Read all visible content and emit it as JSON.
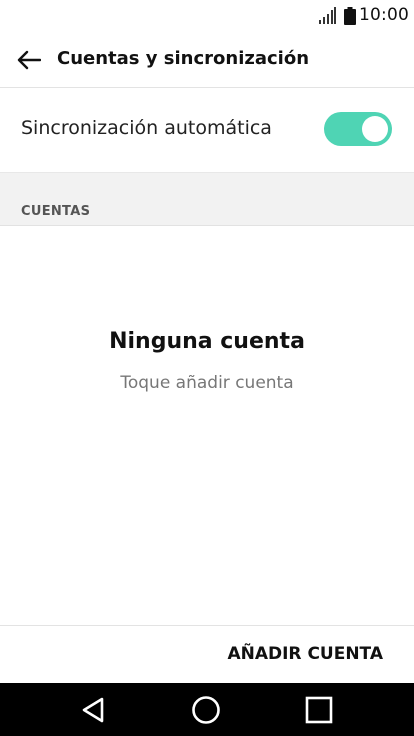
{
  "status_bar": {
    "time": "10:00",
    "icons": [
      "signal-icon",
      "battery-icon"
    ]
  },
  "app_bar": {
    "title": "Cuentas y sincronización",
    "back_icon": "arrow-left-icon"
  },
  "auto_sync": {
    "label": "Sincronización automática",
    "enabled": true,
    "toggle_color": "#4fd4b4"
  },
  "accounts": {
    "section_title": "CUENTAS",
    "empty_title": "Ninguna cuenta",
    "empty_hint": "Toque añadir cuenta"
  },
  "bottom_action": {
    "add_account_label": "AÑADIR CUENTA"
  },
  "nav_bar": {
    "icons": [
      "back-triangle-icon",
      "home-circle-icon",
      "recents-square-icon"
    ]
  }
}
